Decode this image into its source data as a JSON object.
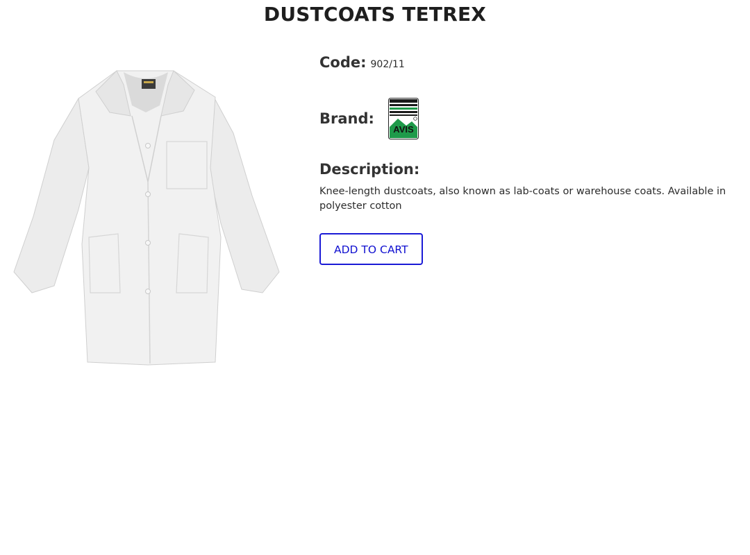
{
  "product": {
    "title": "DUSTCOATS TETREX",
    "image_icon": "white-dustcoat-product-photo",
    "code_label": "Code:",
    "code_value": "902/11",
    "brand_label": "Brand:",
    "brand_logo_icon": "avis-brand-logo",
    "brand_logo_text": "AVIS",
    "description_label": "Description:",
    "description_text": "Knee-length dustcoats, also known as lab-coats or warehouse coats. Available in polyester cotton",
    "add_to_cart_label": "ADD TO CART"
  },
  "colors": {
    "button_accent": "#1a1ad6",
    "brand_green": "#1e9a4a"
  }
}
